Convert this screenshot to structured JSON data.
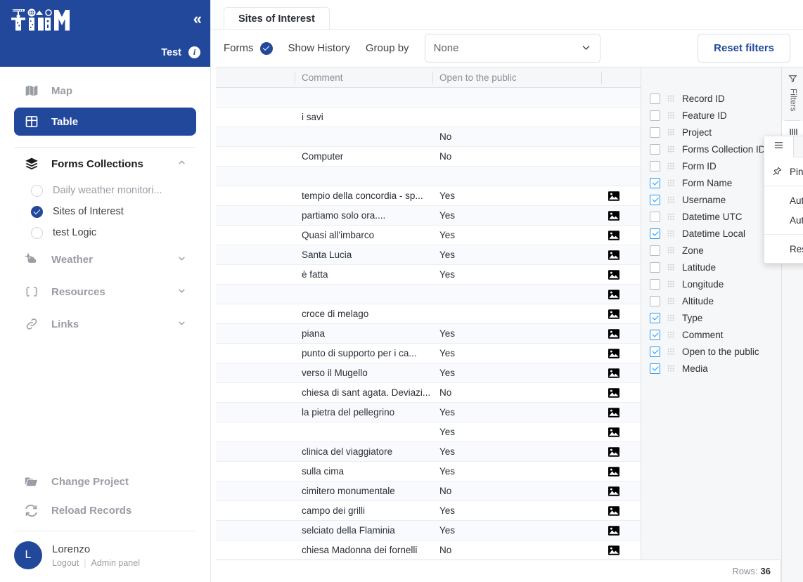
{
  "sidebar": {
    "brand": "TRIM",
    "collapse_icon": "chevrons-left-icon",
    "project_label": "Test",
    "info_icon": "info-icon",
    "nav": [
      {
        "label": "Map",
        "icon": "map-icon",
        "active": false
      },
      {
        "label": "Table",
        "icon": "table-icon",
        "active": true
      }
    ],
    "sections": [
      {
        "label": "Forms Collections",
        "icon": "layers-icon",
        "expanded": true,
        "chevron": "chevron-up-icon",
        "items": [
          {
            "label": "Daily weather monitori...",
            "selected": false
          },
          {
            "label": "Sites of Interest",
            "selected": true
          },
          {
            "label": "test Logic",
            "selected": false
          }
        ]
      },
      {
        "label": "Weather",
        "icon": "weather-icon",
        "expanded": false,
        "chevron": "chevron-down-icon",
        "items": []
      },
      {
        "label": "Resources",
        "icon": "resources-icon",
        "expanded": false,
        "chevron": "chevron-down-icon",
        "items": []
      },
      {
        "label": "Links",
        "icon": "link-icon",
        "expanded": false,
        "chevron": "chevron-down-icon",
        "items": []
      }
    ],
    "actions": [
      {
        "label": "Change Project",
        "icon": "folder-icon"
      },
      {
        "label": "Reload Records",
        "icon": "refresh-icon"
      }
    ],
    "user": {
      "avatar_initial": "L",
      "name": "Lorenzo",
      "logout_label": "Logout",
      "admin_label": "Admin panel",
      "separator": "|"
    }
  },
  "header": {
    "tab_label": "Sites of Interest"
  },
  "toolbar": {
    "forms_label": "Forms",
    "forms_checked": true,
    "show_history_label": "Show History",
    "group_by_label": "Group by",
    "group_by_value": "None",
    "group_by_chevron": "chevron-down-icon",
    "reset_filters_label": "Reset filters"
  },
  "grid": {
    "columns": [
      "",
      "Comment",
      "Open to the public",
      ""
    ],
    "rows": [
      {
        "comment": "",
        "public": "",
        "media": false
      },
      {
        "comment": "i savi",
        "public": "",
        "media": false
      },
      {
        "comment": "",
        "public": "No",
        "media": false
      },
      {
        "comment": "Computer",
        "public": "No",
        "media": false
      },
      {
        "comment": "",
        "public": "",
        "media": false
      },
      {
        "comment": "tempio della concordia - sp...",
        "public": "Yes",
        "media": true
      },
      {
        "comment": "partiamo solo ora....",
        "public": "Yes",
        "media": true
      },
      {
        "comment": "Quasi all'imbarco",
        "public": "Yes",
        "media": true
      },
      {
        "comment": "Santa Lucia",
        "public": "Yes",
        "media": true
      },
      {
        "comment": "è fatta",
        "public": "Yes",
        "media": true
      },
      {
        "comment": "",
        "public": "",
        "media": true
      },
      {
        "comment": "croce di melago",
        "public": "",
        "media": true
      },
      {
        "comment": "piana",
        "public": "Yes",
        "media": true
      },
      {
        "comment": "punto di supporto per i ca...",
        "public": "Yes",
        "media": true
      },
      {
        "comment": "verso il Mugello",
        "public": "Yes",
        "media": true
      },
      {
        "comment": "chiesa di sant agata. Deviazi...",
        "public": "No",
        "media": true
      },
      {
        "comment": "la pietra del pellegrino",
        "public": "Yes",
        "media": true
      },
      {
        "comment": "",
        "public": "Yes",
        "media": true
      },
      {
        "comment": "clinica del viaggiatore",
        "public": "Yes",
        "media": true
      },
      {
        "comment": "sulla cima",
        "public": "Yes",
        "media": true
      },
      {
        "comment": "cimitero monumentale",
        "public": "No",
        "media": true
      },
      {
        "comment": "campo dei grilli",
        "public": "Yes",
        "media": true
      },
      {
        "comment": "selciato della Flaminia",
        "public": "Yes",
        "media": true
      },
      {
        "comment": "chiesa Madonna dei fornelli",
        "public": "No",
        "media": true
      }
    ],
    "status": {
      "rows_label": "Rows:",
      "rows_count": "36"
    }
  },
  "context_menu": {
    "tabs": [
      {
        "icon": "menu-icon",
        "active": true
      },
      {
        "icon": "filter-icon",
        "active": false
      },
      {
        "icon": "columns-icon",
        "active": false
      }
    ],
    "groups": [
      [
        {
          "label": "Pin Column",
          "icon": "pin-icon",
          "submenu": true,
          "arrow": "chevron-right-icon"
        }
      ],
      [
        {
          "label": "Autosize This Column"
        },
        {
          "label": "Autosize All Columns"
        }
      ],
      [
        {
          "label": "Reset Columns"
        }
      ]
    ]
  },
  "columns_panel": {
    "items": [
      {
        "label": "Record ID",
        "checked": false
      },
      {
        "label": "Feature ID",
        "checked": false
      },
      {
        "label": "Project",
        "checked": false
      },
      {
        "label": "Forms Collection ID",
        "checked": false
      },
      {
        "label": "Form ID",
        "checked": false
      },
      {
        "label": "Form Name",
        "checked": true
      },
      {
        "label": "Username",
        "checked": true
      },
      {
        "label": "Datetime UTC",
        "checked": false
      },
      {
        "label": "Datetime Local",
        "checked": true
      },
      {
        "label": "Zone",
        "checked": false
      },
      {
        "label": "Latitude",
        "checked": false
      },
      {
        "label": "Longitude",
        "checked": false
      },
      {
        "label": "Altitude",
        "checked": false
      },
      {
        "label": "Type",
        "checked": true
      },
      {
        "label": "Comment",
        "checked": true
      },
      {
        "label": "Open to the public",
        "checked": true
      },
      {
        "label": "Media",
        "checked": true
      }
    ]
  },
  "side_tabs": [
    {
      "label": "Filters",
      "icon": "filter-icon",
      "active": false
    },
    {
      "label": "Columns",
      "icon": "columns-icon",
      "active": true
    }
  ],
  "colors": {
    "brand_blue": "#22489b",
    "accent_checkbox": "#2196f3",
    "row_alt": "#f8fafd",
    "header_grey": "#f6f7f8",
    "border": "#e0e2e7"
  }
}
